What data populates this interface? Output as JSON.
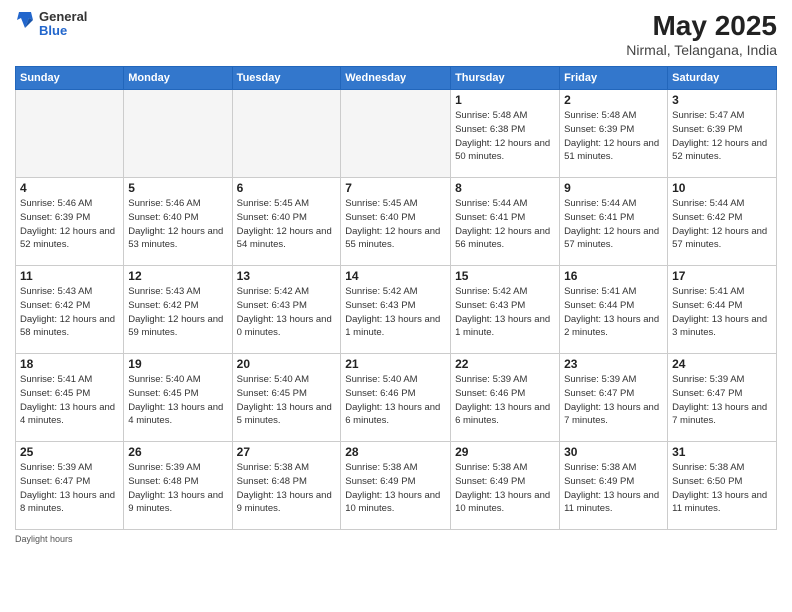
{
  "logo": {
    "general": "General",
    "blue": "Blue"
  },
  "title": "May 2025",
  "subtitle": "Nirmal, Telangana, India",
  "weekdays": [
    "Sunday",
    "Monday",
    "Tuesday",
    "Wednesday",
    "Thursday",
    "Friday",
    "Saturday"
  ],
  "days": [
    {
      "date": "",
      "info": ""
    },
    {
      "date": "",
      "info": ""
    },
    {
      "date": "",
      "info": ""
    },
    {
      "date": "",
      "info": ""
    },
    {
      "date": "1",
      "info": "Sunrise: 5:48 AM\nSunset: 6:38 PM\nDaylight: 12 hours\nand 50 minutes."
    },
    {
      "date": "2",
      "info": "Sunrise: 5:48 AM\nSunset: 6:39 PM\nDaylight: 12 hours\nand 51 minutes."
    },
    {
      "date": "3",
      "info": "Sunrise: 5:47 AM\nSunset: 6:39 PM\nDaylight: 12 hours\nand 52 minutes."
    },
    {
      "date": "4",
      "info": "Sunrise: 5:46 AM\nSunset: 6:39 PM\nDaylight: 12 hours\nand 52 minutes."
    },
    {
      "date": "5",
      "info": "Sunrise: 5:46 AM\nSunset: 6:40 PM\nDaylight: 12 hours\nand 53 minutes."
    },
    {
      "date": "6",
      "info": "Sunrise: 5:45 AM\nSunset: 6:40 PM\nDaylight: 12 hours\nand 54 minutes."
    },
    {
      "date": "7",
      "info": "Sunrise: 5:45 AM\nSunset: 6:40 PM\nDaylight: 12 hours\nand 55 minutes."
    },
    {
      "date": "8",
      "info": "Sunrise: 5:44 AM\nSunset: 6:41 PM\nDaylight: 12 hours\nand 56 minutes."
    },
    {
      "date": "9",
      "info": "Sunrise: 5:44 AM\nSunset: 6:41 PM\nDaylight: 12 hours\nand 57 minutes."
    },
    {
      "date": "10",
      "info": "Sunrise: 5:44 AM\nSunset: 6:42 PM\nDaylight: 12 hours\nand 57 minutes."
    },
    {
      "date": "11",
      "info": "Sunrise: 5:43 AM\nSunset: 6:42 PM\nDaylight: 12 hours\nand 58 minutes."
    },
    {
      "date": "12",
      "info": "Sunrise: 5:43 AM\nSunset: 6:42 PM\nDaylight: 12 hours\nand 59 minutes."
    },
    {
      "date": "13",
      "info": "Sunrise: 5:42 AM\nSunset: 6:43 PM\nDaylight: 13 hours\nand 0 minutes."
    },
    {
      "date": "14",
      "info": "Sunrise: 5:42 AM\nSunset: 6:43 PM\nDaylight: 13 hours\nand 1 minute."
    },
    {
      "date": "15",
      "info": "Sunrise: 5:42 AM\nSunset: 6:43 PM\nDaylight: 13 hours\nand 1 minute."
    },
    {
      "date": "16",
      "info": "Sunrise: 5:41 AM\nSunset: 6:44 PM\nDaylight: 13 hours\nand 2 minutes."
    },
    {
      "date": "17",
      "info": "Sunrise: 5:41 AM\nSunset: 6:44 PM\nDaylight: 13 hours\nand 3 minutes."
    },
    {
      "date": "18",
      "info": "Sunrise: 5:41 AM\nSunset: 6:45 PM\nDaylight: 13 hours\nand 4 minutes."
    },
    {
      "date": "19",
      "info": "Sunrise: 5:40 AM\nSunset: 6:45 PM\nDaylight: 13 hours\nand 4 minutes."
    },
    {
      "date": "20",
      "info": "Sunrise: 5:40 AM\nSunset: 6:45 PM\nDaylight: 13 hours\nand 5 minutes."
    },
    {
      "date": "21",
      "info": "Sunrise: 5:40 AM\nSunset: 6:46 PM\nDaylight: 13 hours\nand 6 minutes."
    },
    {
      "date": "22",
      "info": "Sunrise: 5:39 AM\nSunset: 6:46 PM\nDaylight: 13 hours\nand 6 minutes."
    },
    {
      "date": "23",
      "info": "Sunrise: 5:39 AM\nSunset: 6:47 PM\nDaylight: 13 hours\nand 7 minutes."
    },
    {
      "date": "24",
      "info": "Sunrise: 5:39 AM\nSunset: 6:47 PM\nDaylight: 13 hours\nand 7 minutes."
    },
    {
      "date": "25",
      "info": "Sunrise: 5:39 AM\nSunset: 6:47 PM\nDaylight: 13 hours\nand 8 minutes."
    },
    {
      "date": "26",
      "info": "Sunrise: 5:39 AM\nSunset: 6:48 PM\nDaylight: 13 hours\nand 9 minutes."
    },
    {
      "date": "27",
      "info": "Sunrise: 5:38 AM\nSunset: 6:48 PM\nDaylight: 13 hours\nand 9 minutes."
    },
    {
      "date": "28",
      "info": "Sunrise: 5:38 AM\nSunset: 6:49 PM\nDaylight: 13 hours\nand 10 minutes."
    },
    {
      "date": "29",
      "info": "Sunrise: 5:38 AM\nSunset: 6:49 PM\nDaylight: 13 hours\nand 10 minutes."
    },
    {
      "date": "30",
      "info": "Sunrise: 5:38 AM\nSunset: 6:49 PM\nDaylight: 13 hours\nand 11 minutes."
    },
    {
      "date": "31",
      "info": "Sunrise: 5:38 AM\nSunset: 6:50 PM\nDaylight: 13 hours\nand 11 minutes."
    }
  ],
  "footer": "Daylight hours"
}
